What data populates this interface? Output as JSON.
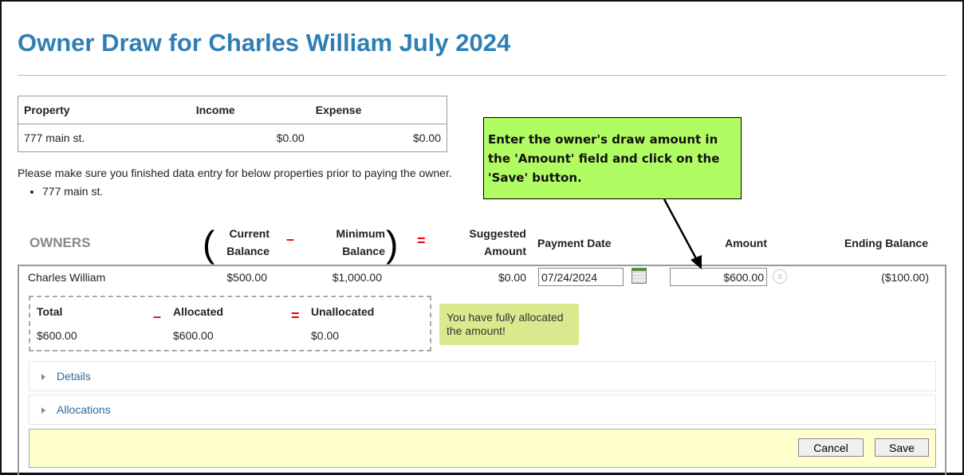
{
  "title": "Owner Draw for Charles William July 2024",
  "property_table": {
    "headers": [
      "Property",
      "Income",
      "Expense"
    ],
    "rows": [
      {
        "property": "777 main st.",
        "income": "$0.00",
        "expense": "$0.00"
      }
    ]
  },
  "notice": "Please make sure you finished data entry for below properties prior to paying the owner.",
  "properties_list": [
    "777 main st."
  ],
  "owners": {
    "heading": "OWNERS",
    "columns": {
      "current_balance": "Current Balance",
      "minus": "–",
      "minimum_balance": "Minimum Balance",
      "equals": "=",
      "suggested_amount": "Suggested Amount",
      "payment_date": "Payment Date",
      "amount": "Amount",
      "ending_balance": "Ending Balance"
    },
    "row": {
      "name": "Charles William",
      "current_balance": "$500.00",
      "minimum_balance": "$1,000.00",
      "suggested_amount": "$0.00",
      "payment_date": "07/24/2024",
      "amount": "$600.00",
      "ending_balance": "($100.00)"
    }
  },
  "allocation": {
    "total_label": "Total",
    "allocated_label": "Allocated",
    "unallocated_label": "Unallocated",
    "minus": "–",
    "equals": "=",
    "total": "$600.00",
    "allocated": "$600.00",
    "unallocated": "$0.00",
    "message": "You have fully allocated the amount!"
  },
  "sections": [
    "Details",
    "Allocations"
  ],
  "buttons": {
    "cancel": "Cancel",
    "save": "Save"
  },
  "callout": "Enter the owner's draw amount in the 'Amount' field and click on the 'Save' button.",
  "colors": {
    "title": "#2f7fb5",
    "callout_bg": "#b1fc63",
    "footer_bg": "#ffffcc",
    "note_bg": "#d9ea8e"
  }
}
